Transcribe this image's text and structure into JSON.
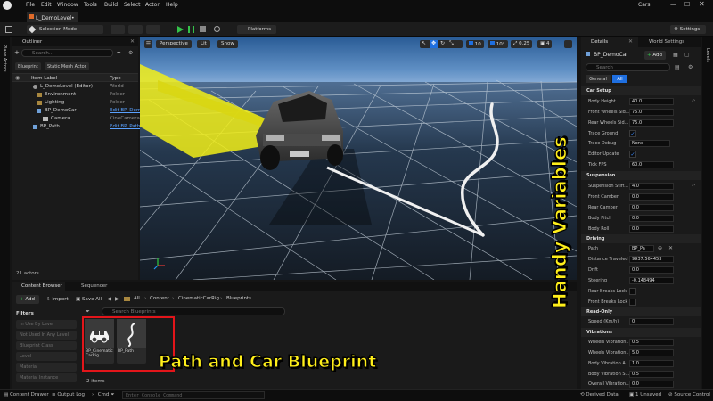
{
  "window": {
    "app_title": "Cars"
  },
  "menu": [
    "File",
    "Edit",
    "Window",
    "Tools",
    "Build",
    "Select",
    "Actor",
    "Help"
  ],
  "level_tab": "L_DemoLevel•",
  "toolbar": {
    "selection_mode": "Selection Mode",
    "platforms": "Platforms",
    "settings": "Settings"
  },
  "left_strip_label": "Place Actors",
  "outliner": {
    "title": "Outliner",
    "search_placeholder": "Search...",
    "chips": [
      "Blueprint",
      "Static Mesh Actor"
    ],
    "col_label": "Item Label",
    "col_type": "Type",
    "rows": [
      {
        "label": "L_DemoLevel (Editor)",
        "type": "World",
        "link": false
      },
      {
        "label": "Environment",
        "type": "Folder",
        "link": false
      },
      {
        "label": "Lighting",
        "type": "Folder",
        "link": false
      },
      {
        "label": "BP_DemoCar",
        "type": "Edit BP_Demo",
        "link": true
      },
      {
        "label": "Camera",
        "type": "CineCameraA",
        "link": false
      },
      {
        "label": "BP_Path",
        "type": "Edit BP_Path",
        "link": true
      }
    ],
    "footer": "21 actors"
  },
  "viewport": {
    "perspective": "Perspective",
    "lit": "Lit",
    "show": "Show",
    "grid": "10",
    "rot": "10°",
    "scale": "0.25",
    "cam": "4"
  },
  "details": {
    "tab_details": "Details",
    "tab_world": "World Settings",
    "object": "BP_DemoCar",
    "add": "Add",
    "search_placeholder": "Search",
    "tabs": [
      "General",
      "All"
    ],
    "sections": {
      "car_setup": "Car Setup",
      "suspension": "Suspension",
      "driving": "Driving",
      "read_only": "Read-Only",
      "vibrations": "Vibrations"
    },
    "car_setup": [
      {
        "name": "Body Height",
        "value": "40.0"
      },
      {
        "name": "Front Wheels Sid...",
        "value": "75.0"
      },
      {
        "name": "Rear Wheels Sid...",
        "value": "75.0"
      },
      {
        "name": "Trace Ground",
        "value": "✓"
      },
      {
        "name": "Trace Debug",
        "value": "None"
      },
      {
        "name": "Editor Update",
        "value": "✓"
      },
      {
        "name": "Tick FPS",
        "value": "60.0"
      }
    ],
    "suspension": [
      {
        "name": "Suspension Stiff...",
        "value": "4.0"
      },
      {
        "name": "Front Camber",
        "value": "0.0"
      },
      {
        "name": "Rear Camber",
        "value": "0.0"
      },
      {
        "name": "Body Pitch",
        "value": "0.0"
      },
      {
        "name": "Body Roll",
        "value": "0.0"
      }
    ],
    "driving": [
      {
        "name": "Path",
        "value": "BP_Pa"
      },
      {
        "name": "Distance Traveled",
        "value": "9937.564453"
      },
      {
        "name": "Drift",
        "value": "0.0"
      },
      {
        "name": "Steering",
        "value": "-0.148494"
      },
      {
        "name": "Rear Breaks Lock",
        "value": ""
      },
      {
        "name": "Front Breaks Lock",
        "value": ""
      }
    ],
    "read_only": [
      {
        "name": "Speed (Km/h)",
        "value": "0"
      }
    ],
    "vibrations": [
      {
        "name": "Wheels Vibration...",
        "value": "0.5"
      },
      {
        "name": "Wheels Vibration...",
        "value": "5.0"
      },
      {
        "name": "Body Vibration A...",
        "value": "1.0"
      },
      {
        "name": "Body Vibration S...",
        "value": "0.5"
      },
      {
        "name": "Overall Vibration...",
        "value": "0.0"
      }
    ]
  },
  "right_strip_label": "Levels",
  "bottom": {
    "tab_content": "Content Browser",
    "tab_sequencer": "Sequencer",
    "add": "Add",
    "import": "Import",
    "save_all": "Save All",
    "breadcrumb": [
      "All",
      "Content",
      "CinematicCarRig",
      "Blueprints"
    ],
    "search_placeholder": "Search Blueprints",
    "filters_title": "Filters",
    "filters": [
      "In Use By Level",
      "Not Used In Any Level",
      "Blueprint Class",
      "Level",
      "Material",
      "Material Instance"
    ],
    "assets": [
      "BP_CinematicCarRig",
      "BP_Path"
    ],
    "count": "2 items"
  },
  "statusbar": {
    "content_drawer": "Content Drawer",
    "output_log": "Output Log",
    "cmd": "Cmd",
    "console_placeholder": "Enter Console Command",
    "derived_data": "Derived Data",
    "unsaved": "1 Unsaved",
    "source_control": "Source Control"
  },
  "overlays": {
    "path_and_car": "Path and Car Blueprint",
    "handy": "Handy Variables"
  },
  "colors": {
    "accent_blue": "#1f6fe0",
    "overlay_yellow": "#ffef1a",
    "highlight_red": "#e3151a"
  }
}
